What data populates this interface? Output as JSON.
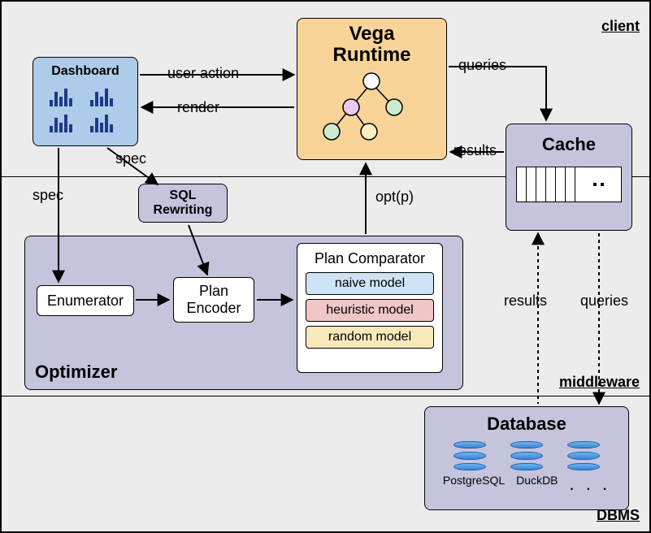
{
  "layers": {
    "client": "client",
    "middleware": "middleware",
    "dbms": "DBMS"
  },
  "dashboard": {
    "title": "Dashboard"
  },
  "vega": {
    "title_l1": "Vega",
    "title_l2": "Runtime"
  },
  "cache": {
    "title": "Cache"
  },
  "sql_rewriting": {
    "l1": "SQL",
    "l2": "Rewriting"
  },
  "optimizer": {
    "title": "Optimizer",
    "enumerator": "Enumerator",
    "plan_encoder_l1": "Plan",
    "plan_encoder_l2": "Encoder",
    "plan_comparator": "Plan Comparator",
    "models": {
      "naive": "naive model",
      "heuristic": "heuristic model",
      "random": "random model"
    }
  },
  "database": {
    "title": "Database",
    "engines": {
      "postgresql": "PostgreSQL",
      "duckdb": "DuckDB",
      "more": ". . ."
    }
  },
  "edges": {
    "user_action": "user action",
    "render": "render",
    "spec1": "spec",
    "spec2": "spec",
    "optp": "opt(p)",
    "queries1": "queries",
    "results1": "results",
    "queries2": "queries",
    "results2": "results"
  }
}
